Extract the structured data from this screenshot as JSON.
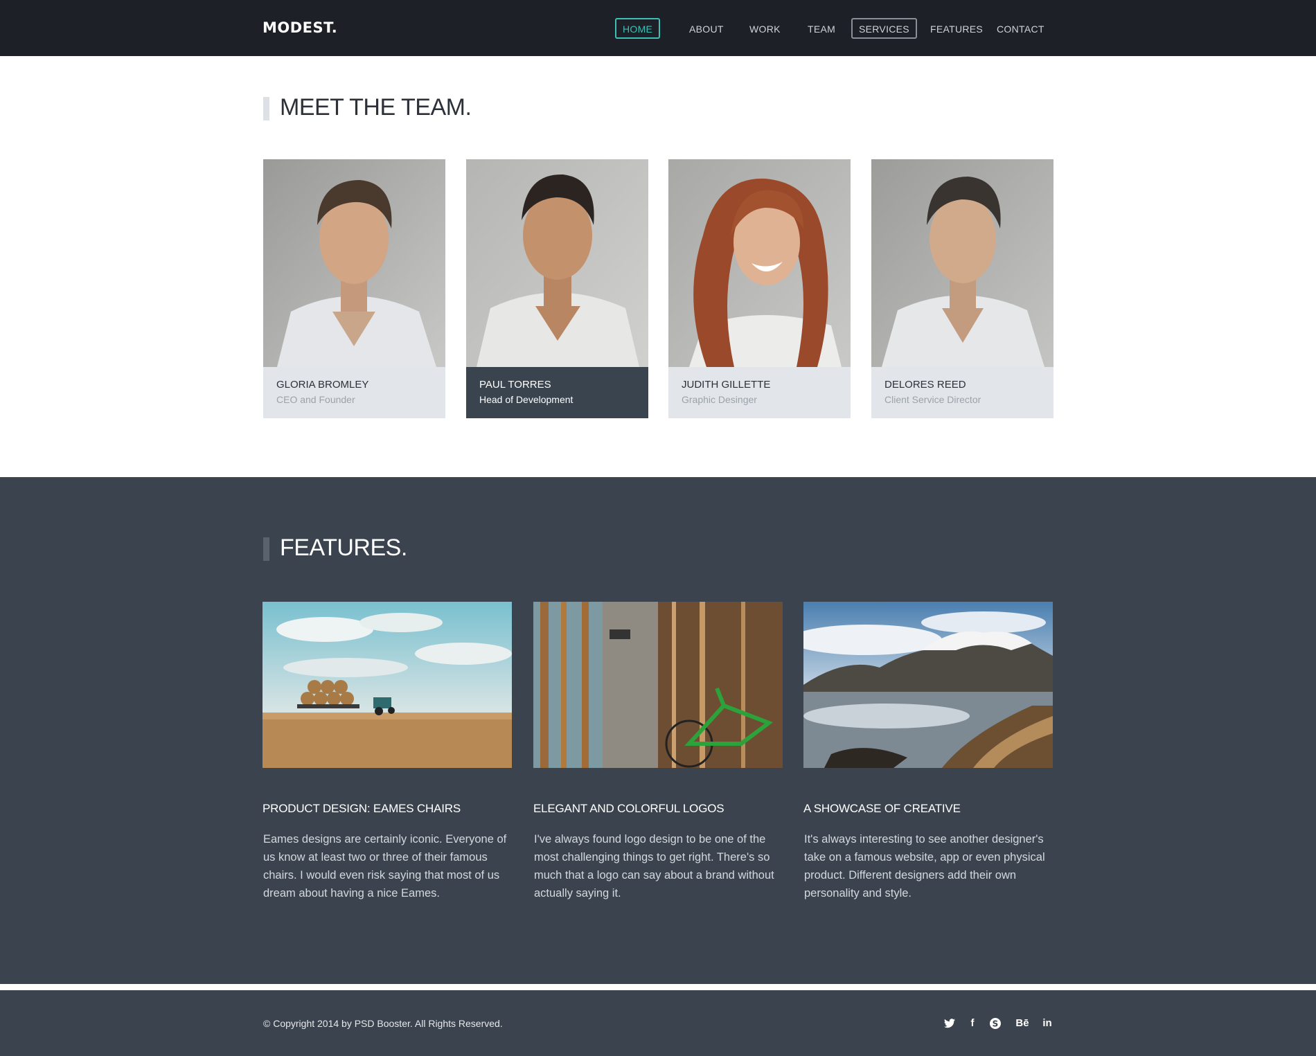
{
  "header": {
    "logo": "MODEST.",
    "nav": [
      {
        "label": "HOME",
        "state": "active"
      },
      {
        "label": "ABOUT",
        "state": "normal"
      },
      {
        "label": "WORK",
        "state": "normal"
      },
      {
        "label": "TEAM",
        "state": "normal"
      },
      {
        "label": "SERVICES",
        "state": "boxed"
      },
      {
        "label": "FEATURES",
        "state": "normal"
      },
      {
        "label": "CONTACT",
        "state": "normal"
      }
    ]
  },
  "team": {
    "title": "MEET THE TEAM.",
    "members": [
      {
        "name": "GLORIA BROMLEY",
        "role": "CEO and Founder"
      },
      {
        "name": "PAUL TORRES",
        "role": "Head of Development"
      },
      {
        "name": "JUDITH GILLETTE",
        "role": "Graphic Desinger"
      },
      {
        "name": "DELORES REED",
        "role": "Client Service Director"
      }
    ]
  },
  "features": {
    "title": "FEATURES.",
    "items": [
      {
        "title": "PRODUCT DESIGN: EAMES CHAIRS",
        "text": "Eames designs are certainly iconic. Everyone of us know at least two or three of their famous chairs. I would even risk saying that most of us dream about having a nice Eames."
      },
      {
        "title": "ELEGANT AND COLORFUL LOGOS",
        "text": "I've always found logo design to be one of the most challenging things to get right. There's so much that a logo can say about a brand without actually saying it."
      },
      {
        "title": "A SHOWCASE OF CREATIVE",
        "text": "It's always interesting to see another designer's take on a famous website, app or even physical product. Different designers add their own personality and style."
      }
    ]
  },
  "footer": {
    "copyright": "© Copyright 2014 by PSD Booster. All Rights Reserved.",
    "social": [
      {
        "icon": "twitter-icon",
        "glyph": "t"
      },
      {
        "icon": "facebook-icon",
        "glyph": "f"
      },
      {
        "icon": "skype-icon",
        "glyph": "S"
      },
      {
        "icon": "behance-icon",
        "glyph": "Bē"
      },
      {
        "icon": "linkedin-icon",
        "glyph": "in"
      }
    ]
  },
  "colors": {
    "accent": "#3dc0b5",
    "header_bg": "#1d2127",
    "dark_bg": "#3b444e",
    "caption_bg": "#e2e6ea"
  }
}
